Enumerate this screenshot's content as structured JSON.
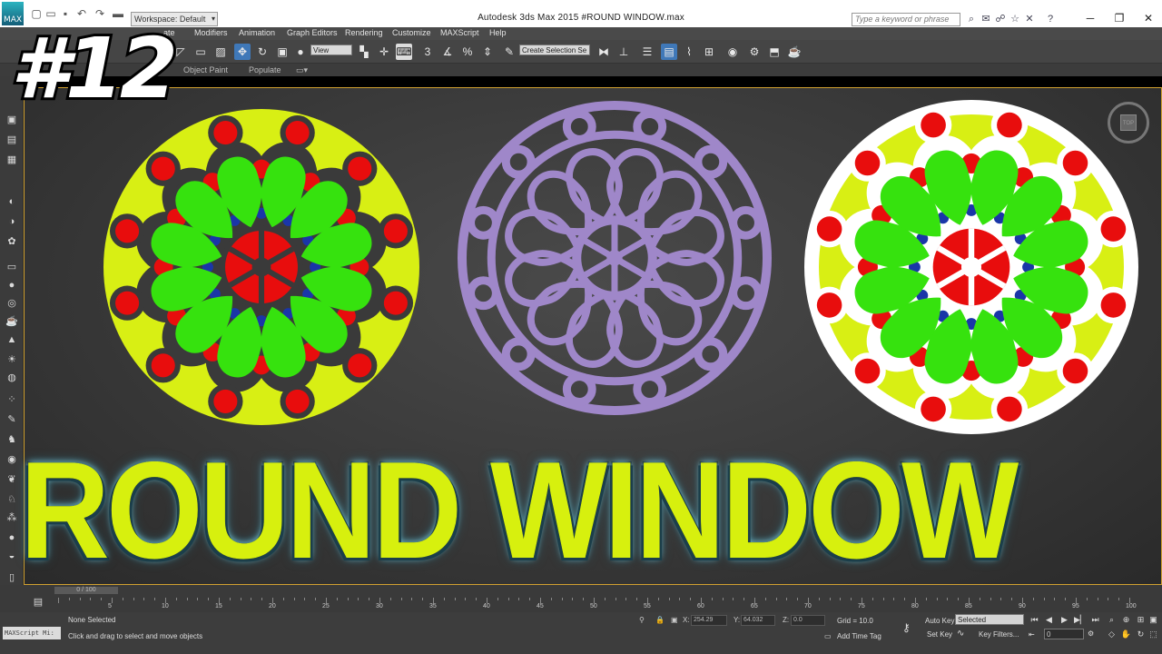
{
  "titlebar": {
    "workspace": "Workspace: Default",
    "app_title": "Autodesk 3ds Max  2015     #ROUND WINDOW.max",
    "search_placeholder": "Type a keyword or phrase",
    "logo_text": "MAX"
  },
  "menu": [
    "Modifiers",
    "Animation",
    "Graph Editors",
    "Rendering",
    "Customize",
    "MAXScript",
    "Help"
  ],
  "menu_partial": "ate",
  "toolbar": {
    "view_dropdown": "View",
    "selection_set": "Create Selection Se"
  },
  "ribbon": {
    "object_paint": "Object Paint",
    "populate": "Populate"
  },
  "overlay": {
    "episode": "#12",
    "headline": "ROUND WINDOW"
  },
  "rosettes": {
    "colors": {
      "yellow": "#d8ef14",
      "green": "#36e20e",
      "red": "#e80d0d",
      "blue": "#1a36a8",
      "dark": "#3a3a3a",
      "lavender": "#9f87c9",
      "white": "#ffffff"
    }
  },
  "timeline": {
    "slider": "0 / 100",
    "ticks": [
      0,
      5,
      10,
      15,
      20,
      25,
      30,
      35,
      40,
      45,
      50,
      55,
      60,
      65,
      70,
      75,
      80,
      85,
      90,
      95,
      100
    ]
  },
  "status": {
    "maxscript": "MAXScript Mi:",
    "selection": "None Selected",
    "prompt": "Click and drag to select and move objects",
    "x_label": "X:",
    "x_value": "254.29",
    "y_label": "Y:",
    "y_value": "64.032",
    "z_label": "Z:",
    "z_value": "0.0",
    "grid": "Grid = 10.0",
    "add_time_tag": "Add Time Tag",
    "auto_key": "Auto Key",
    "auto_key_value": "Selected",
    "set_key": "Set Key",
    "key_filters": "Key Filters...",
    "frame": "0"
  }
}
